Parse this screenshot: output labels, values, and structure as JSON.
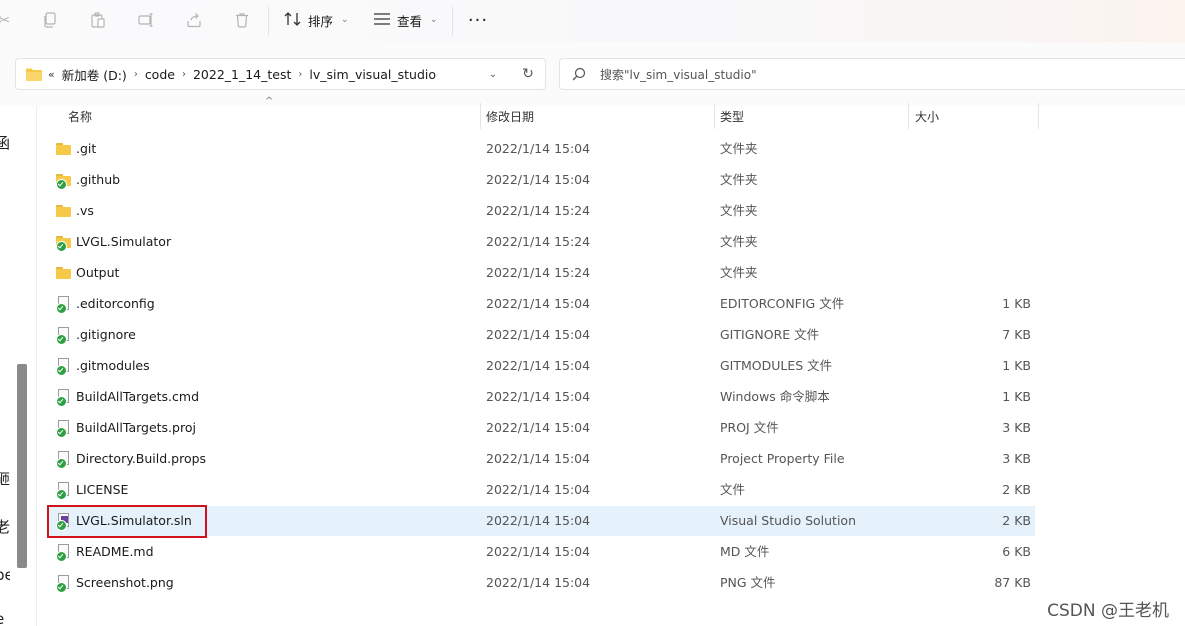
{
  "toolbar": {
    "icons": [
      "cut-icon",
      "copy-icon",
      "paste-icon",
      "rename-icon",
      "share-icon",
      "delete-icon"
    ],
    "sort_label": "排序",
    "view_label": "查看",
    "more_label": "···"
  },
  "address": {
    "overflow": "«",
    "crumbs": [
      "新加卷 (D:)",
      "code",
      "2022_1_14_test",
      "lv_sim_visual_studio"
    ]
  },
  "search": {
    "placeholder": "搜索\"lv_sim_visual_studio\""
  },
  "columns": {
    "name": "名称",
    "modified": "修改日期",
    "type": "类型",
    "size": "大小"
  },
  "left_pane_fragments": [
    "函",
    "砸",
    "老",
    "pe",
    "e"
  ],
  "files": [
    {
      "name": ".git",
      "date": "2022/1/14 15:04",
      "type": "文件夹",
      "size": "",
      "icon": "folder-icon"
    },
    {
      "name": ".github",
      "date": "2022/1/14 15:04",
      "type": "文件夹",
      "size": "",
      "icon": "folder-synced-icon"
    },
    {
      "name": ".vs",
      "date": "2022/1/14 15:24",
      "type": "文件夹",
      "size": "",
      "icon": "folder-icon"
    },
    {
      "name": "LVGL.Simulator",
      "date": "2022/1/14 15:24",
      "type": "文件夹",
      "size": "",
      "icon": "folder-synced-icon"
    },
    {
      "name": "Output",
      "date": "2022/1/14 15:24",
      "type": "文件夹",
      "size": "",
      "icon": "folder-icon"
    },
    {
      "name": ".editorconfig",
      "date": "2022/1/14 15:04",
      "type": "EDITORCONFIG 文件",
      "size": "1 KB",
      "icon": "file-synced-icon"
    },
    {
      "name": ".gitignore",
      "date": "2022/1/14 15:04",
      "type": "GITIGNORE 文件",
      "size": "7 KB",
      "icon": "file-synced-icon"
    },
    {
      "name": ".gitmodules",
      "date": "2022/1/14 15:04",
      "type": "GITMODULES 文件",
      "size": "1 KB",
      "icon": "file-synced-icon"
    },
    {
      "name": "BuildAllTargets.cmd",
      "date": "2022/1/14 15:04",
      "type": "Windows 命令脚本",
      "size": "1 KB",
      "icon": "script-synced-icon"
    },
    {
      "name": "BuildAllTargets.proj",
      "date": "2022/1/14 15:04",
      "type": "PROJ 文件",
      "size": "3 KB",
      "icon": "file-synced-icon"
    },
    {
      "name": "Directory.Build.props",
      "date": "2022/1/14 15:04",
      "type": "Project Property File",
      "size": "3 KB",
      "icon": "file-synced-icon"
    },
    {
      "name": "LICENSE",
      "date": "2022/1/14 15:04",
      "type": "文件",
      "size": "2 KB",
      "icon": "file-synced-icon"
    },
    {
      "name": "LVGL.Simulator.sln",
      "date": "2022/1/14 15:04",
      "type": "Visual Studio Solution",
      "size": "2 KB",
      "icon": "vs-solution-synced-icon",
      "selected": true
    },
    {
      "name": "README.md",
      "date": "2022/1/14 15:04",
      "type": "MD 文件",
      "size": "6 KB",
      "icon": "file-synced-icon"
    },
    {
      "name": "Screenshot.png",
      "date": "2022/1/14 15:04",
      "type": "PNG 文件",
      "size": "87 KB",
      "icon": "image-synced-icon"
    }
  ],
  "watermark": "CSDN @王老机",
  "colors": {
    "selection": "#e5f1fb",
    "highlight_border": "#d0121b",
    "folder": "#f7c948",
    "sync_badge": "#2ea043"
  }
}
